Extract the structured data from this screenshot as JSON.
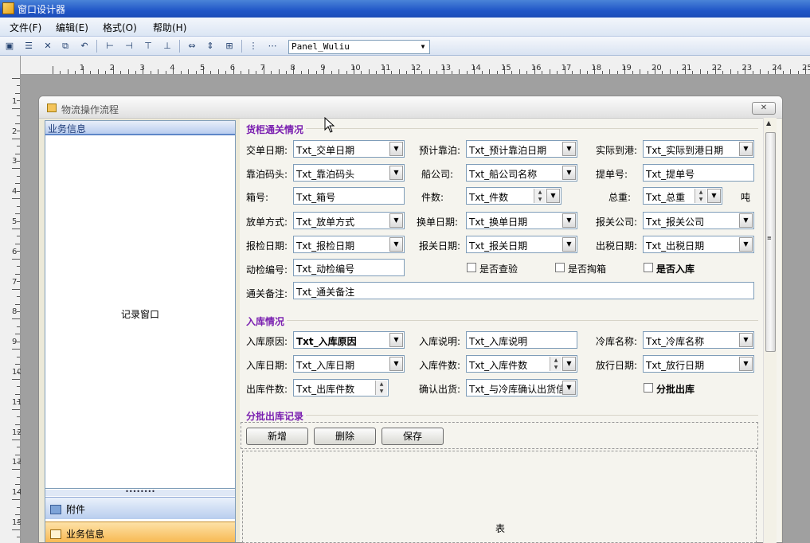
{
  "app": {
    "title": "窗口设计器"
  },
  "menu": [
    {
      "label": "文件(F)"
    },
    {
      "label": "编辑(E)"
    },
    {
      "label": "格式(O)"
    },
    {
      "label": "帮助(H)"
    }
  ],
  "toolbar": {
    "panel_select": "Panel_Wuliu"
  },
  "ruler": {
    "h": [
      "1",
      "2",
      "3",
      "4",
      "5",
      "6",
      "7",
      "8",
      "9",
      "10",
      "11",
      "12",
      "13",
      "14",
      "15",
      "16",
      "17",
      "18",
      "19",
      "20",
      "21",
      "22",
      "23",
      "24",
      "25"
    ],
    "v": [
      "1",
      "2",
      "3",
      "4",
      "5",
      "6",
      "7",
      "8",
      "9",
      "10",
      "11",
      "12",
      "13",
      "14",
      "15"
    ]
  },
  "window": {
    "title": "物流操作流程",
    "close": "✕"
  },
  "left_panel": {
    "header": "业务信息",
    "body": "记录窗口",
    "grip": "••••••••",
    "tab1": "附件",
    "tab2": "业务信息"
  },
  "section1": {
    "title": "货柜通关情况",
    "rows": [
      [
        {
          "label": "交单日期:",
          "value": "Txt_交单日期"
        },
        {
          "label": "预计靠泊:",
          "value": "Txt_预计靠泊日期"
        },
        {
          "label": "实际到港:",
          "value": "Txt_实际到港日期"
        }
      ],
      [
        {
          "label": "靠泊码头:",
          "value": "Txt_靠泊码头"
        },
        {
          "label": "船公司:",
          "value": "Txt_船公司名称"
        },
        {
          "label": "提单号:",
          "value": "Txt_提单号"
        }
      ],
      [
        {
          "label": "箱号:",
          "value": "Txt_箱号"
        },
        {
          "label": "件数:",
          "value": "Txt_件数"
        },
        {
          "label": "总重:",
          "value": "Txt_总重",
          "unit": "吨"
        }
      ],
      [
        {
          "label": "放单方式:",
          "value": "Txt_放单方式"
        },
        {
          "label": "换单日期:",
          "value": "Txt_换单日期"
        },
        {
          "label": "报关公司:",
          "value": "Txt_报关公司"
        }
      ],
      [
        {
          "label": "报检日期:",
          "value": "Txt_报检日期"
        },
        {
          "label": "报关日期:",
          "value": "Txt_报关日期"
        },
        {
          "label": "出税日期:",
          "value": "Txt_出税日期"
        }
      ]
    ],
    "inspection_label": "动检编号:",
    "inspection_value": "Txt_动检编号",
    "check1": "是否查验",
    "check2": "是否掏箱",
    "check3": "是否入库",
    "remark_label": "通关备注:",
    "remark_value": "Txt_通关备注"
  },
  "section2": {
    "title": "入库情况",
    "rows": [
      [
        {
          "label": "入库原因:",
          "value": "Txt_入库原因"
        },
        {
          "label": "入库说明:",
          "value": "Txt_入库说明"
        },
        {
          "label": "冷库名称:",
          "value": "Txt_冷库名称"
        }
      ],
      [
        {
          "label": "入库日期:",
          "value": "Txt_入库日期"
        },
        {
          "label": "入库件数:",
          "value": "Txt_入库件数"
        },
        {
          "label": "放行日期:",
          "value": "Txt_放行日期"
        }
      ],
      [
        {
          "label": "出库件数:",
          "value": "Txt_出库件数"
        },
        {
          "label": "确认出货:",
          "value": "Txt_与冷库确认出货信"
        }
      ]
    ],
    "batch_check": "分批出库"
  },
  "section3": {
    "title": "分批出库记录",
    "add": "新增",
    "delete": "删除",
    "save": "保存",
    "grid": "表"
  }
}
